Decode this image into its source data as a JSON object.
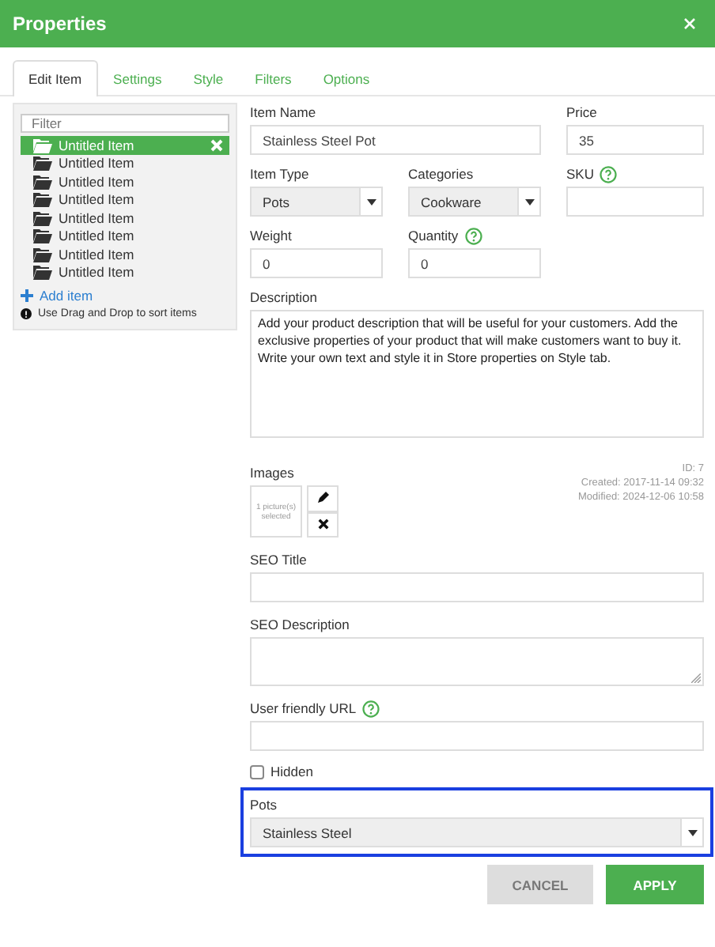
{
  "window": {
    "title": "Properties"
  },
  "tabs": [
    {
      "label": "Edit Item",
      "selected": true
    },
    {
      "label": "Settings",
      "selected": false
    },
    {
      "label": "Style",
      "selected": false
    },
    {
      "label": "Filters",
      "selected": false
    },
    {
      "label": "Options",
      "selected": false
    }
  ],
  "sidebar": {
    "filter_placeholder": "Filter",
    "items": [
      {
        "label": "Untitled Item",
        "selected": true
      },
      {
        "label": "Untitled Item",
        "selected": false
      },
      {
        "label": "Untitled Item",
        "selected": false
      },
      {
        "label": "Untitled Item",
        "selected": false
      },
      {
        "label": "Untitled Item",
        "selected": false
      },
      {
        "label": "Untitled Item",
        "selected": false
      },
      {
        "label": "Untitled Item",
        "selected": false
      },
      {
        "label": "Untitled Item",
        "selected": false
      }
    ],
    "add_label": "Add item",
    "hint": "Use Drag and Drop to sort items"
  },
  "fields": [
    {
      "kind": "text",
      "label": "Item Name",
      "value": "Stainless Steel Pot",
      "help": false
    },
    {
      "kind": "text",
      "label": "Price",
      "value": "35",
      "help": false
    },
    {
      "kind": "select",
      "label": "Item Type",
      "value": "Pots",
      "help": false
    },
    {
      "kind": "select",
      "label": "Categories",
      "value": "Cookware",
      "help": false
    },
    {
      "kind": "text",
      "label": "SKU",
      "help": true
    },
    {
      "kind": "text",
      "label": "Weight",
      "value": "0",
      "help": false
    },
    {
      "kind": "text",
      "label": "Quantity",
      "value": "0",
      "help": true
    },
    {
      "kind": "textarea",
      "label": "Description",
      "value": "Add your product description that will be useful for your customers. Add the exclusive properties of your product that will make customers want to buy it. Write your own text and style it in Store properties on Style tab.",
      "help": false
    }
  ],
  "images": {
    "label": "Images",
    "preview": "1 picture(s) selected",
    "meta": [
      "ID: 7",
      "Created: 2017-11-14 09:32",
      "Modified: 2024-12-06 10:58"
    ]
  },
  "seo_fields": [
    {
      "kind": "text",
      "label": "SEO Title",
      "help": false
    },
    {
      "kind": "textarea",
      "label": "SEO Description",
      "help": false
    },
    {
      "kind": "text",
      "label": "User friendly URL",
      "help": true
    }
  ],
  "hidden": {
    "label": "Hidden",
    "checked": false
  },
  "pots": {
    "label": "Pots",
    "value": "Stainless Steel"
  },
  "buttons": [
    {
      "label": "CANCEL",
      "kind": "secondary"
    },
    {
      "label": "APPLY",
      "kind": "primary"
    }
  ]
}
